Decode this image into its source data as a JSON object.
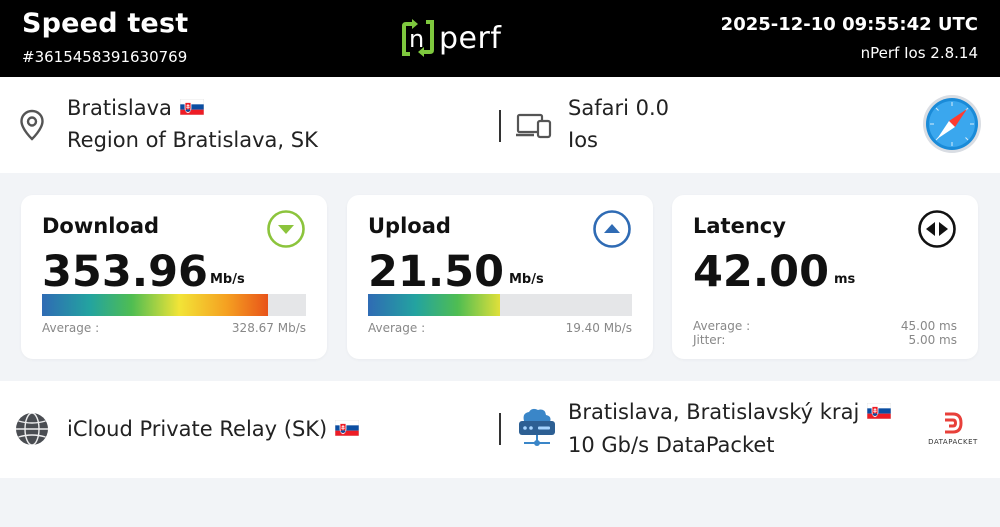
{
  "header": {
    "title": "Speed test",
    "test_id": "#3615458391630769",
    "datetime": "2025-12-10 09:55:42 UTC",
    "version": "nPerf Ios 2.8.14",
    "logo_text": "perf"
  },
  "location": {
    "city": "Bratislava",
    "region": "Region of Bratislava, SK",
    "icon": "location-pin-icon"
  },
  "device": {
    "browser": "Safari 0.0",
    "os": "Ios",
    "icon": "devices-icon",
    "browser_icon": "safari-compass-icon"
  },
  "download": {
    "label": "Download",
    "value": "353.96",
    "unit": "Mb/s",
    "avg_label": "Average :",
    "avg_value": "328.67 Mb/s",
    "fill_fraction": 0.855,
    "icon": "arrow-down-circle-icon",
    "icon_color": "#8cc43c"
  },
  "upload": {
    "label": "Upload",
    "value": "21.50",
    "unit": "Mb/s",
    "avg_label": "Average :",
    "avg_value": "19.40 Mb/s",
    "fill_fraction": 0.5,
    "icon": "arrow-up-circle-icon",
    "icon_color": "#2f6bb4"
  },
  "latency": {
    "label": "Latency",
    "value": "42.00",
    "unit": "ms",
    "avg_label": "Average :",
    "avg_value": "45.00 ms",
    "jitter_label": "Jitter:",
    "jitter_value": "5.00 ms",
    "icon": "left-right-arrows-circle-icon",
    "icon_color": "#111111"
  },
  "isp": {
    "name": "iCloud Private Relay (SK)",
    "icon": "globe-icon"
  },
  "server": {
    "location": "Bratislava, Bratislavský kraj",
    "provider": "10 Gb/s DataPacket",
    "icon": "server-icon",
    "logo_text": "DATAPACKET"
  },
  "colors": {
    "header_bg": "#000000",
    "page_bg": "#f2f4f7",
    "card_bg": "#ffffff"
  }
}
